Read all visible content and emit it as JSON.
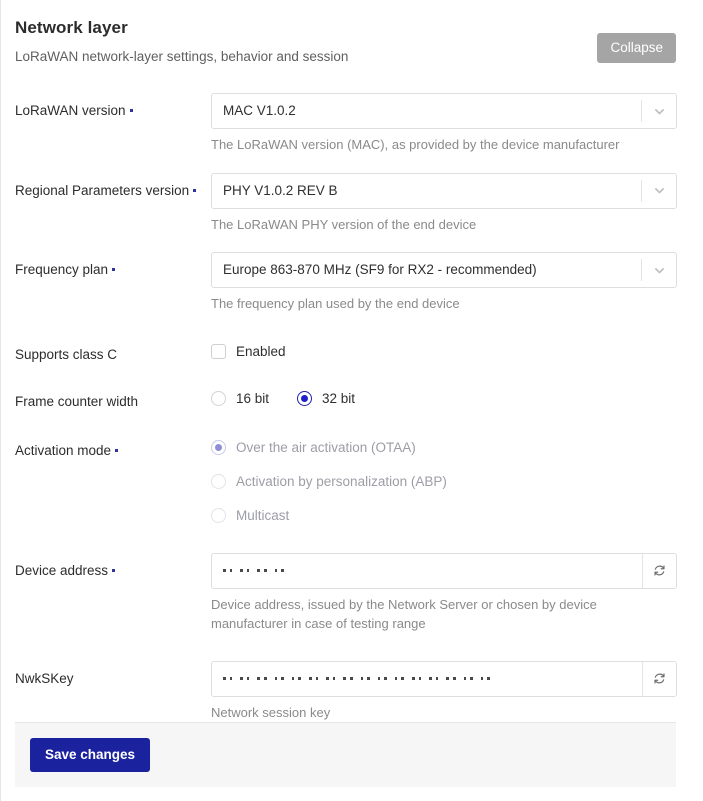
{
  "header": {
    "title": "Network layer",
    "subtitle": "LoRaWAN network-layer settings, behavior and session",
    "collapse_label": "Collapse"
  },
  "colors": {
    "accent": "#1b229e",
    "required_marker": "#31339c",
    "radio_selected": "#2020c8",
    "collapse_button": "#a5a5a5",
    "footer_background": "#f6f6f6",
    "border": "#dededf"
  },
  "fields": {
    "lorawan_version": {
      "label": "LoRaWAN version",
      "required": true,
      "value": "MAC V1.0.2",
      "hint": "The LoRaWAN version (MAC), as provided by the device manufacturer"
    },
    "regional_parameters_version": {
      "label": "Regional Parameters version",
      "required": true,
      "value": "PHY V1.0.2 REV B",
      "hint": "The LoRaWAN PHY version of the end device"
    },
    "frequency_plan": {
      "label": "Frequency plan",
      "required": true,
      "value": "Europe 863-870 MHz (SF9 for RX2 - recommended)",
      "hint": "The frequency plan used by the end device"
    },
    "supports_class_c": {
      "label": "Supports class C",
      "required": false,
      "checkbox_label": "Enabled",
      "checked": false
    },
    "frame_counter_width": {
      "label": "Frame counter width",
      "required": false,
      "options": [
        "16 bit",
        "32 bit"
      ],
      "selected": "32 bit"
    },
    "activation_mode": {
      "label": "Activation mode",
      "required": true,
      "disabled": true,
      "options": [
        "Over the air activation (OTAA)",
        "Activation by personalization (ABP)",
        "Multicast"
      ],
      "selected": "Over the air activation (OTAA)"
    },
    "device_address": {
      "label": "Device address",
      "required": true,
      "masked_byte_count": 4,
      "hint": "Device address, issued by the Network Server or chosen by device manufacturer in case of testing range",
      "regenerate_icon": "refresh-icon"
    },
    "nwkskey": {
      "label": "NwkSKey",
      "required": false,
      "masked_byte_count": 16,
      "hint": "Network session key",
      "regenerate_icon": "refresh-icon"
    }
  },
  "footer": {
    "save_label": "Save changes"
  }
}
